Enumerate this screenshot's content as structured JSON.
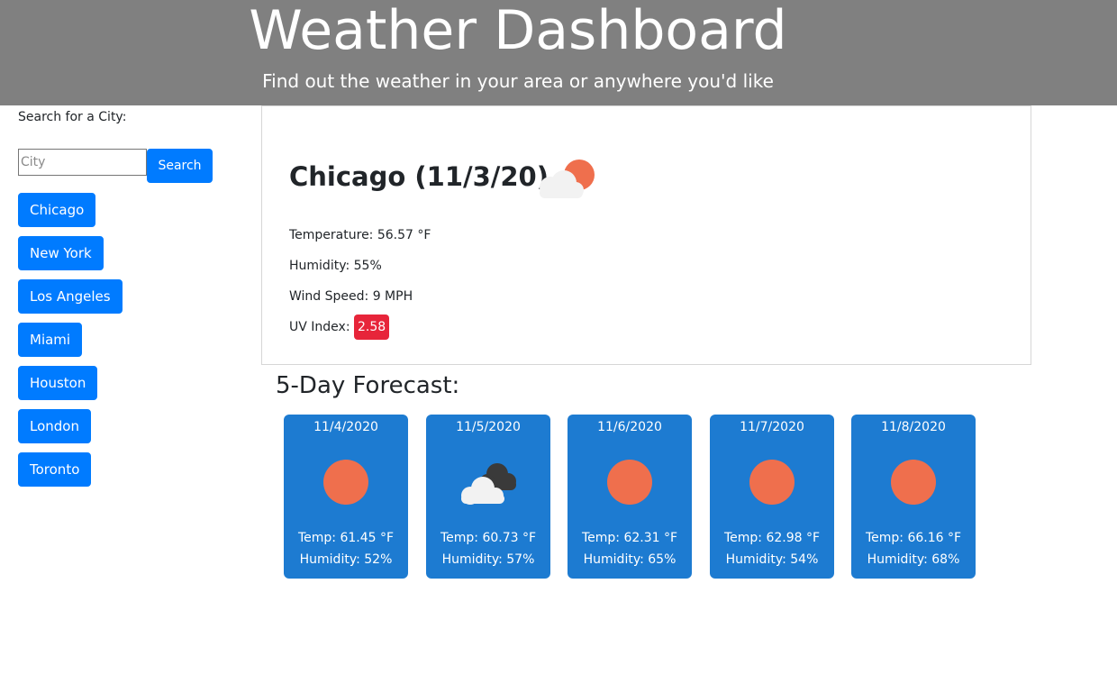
{
  "header": {
    "title": "Weather Dashboard",
    "subtitle": "Find out the weather in your area or anywhere you'd like"
  },
  "sidebar": {
    "search_label": "Search for a City:",
    "search_placeholder": "City",
    "search_value": "",
    "search_button": "Search",
    "cities": [
      "Chicago",
      "New York",
      "Los Angeles",
      "Miami",
      "Houston",
      "London",
      "Toronto"
    ]
  },
  "current": {
    "heading": "Chicago (11/3/20)",
    "icon": "partly-cloudy-icon",
    "temperature": "Temperature: 56.57 °F",
    "humidity": "Humidity: 55%",
    "wind": "Wind Speed: 9 MPH",
    "uv_label": "UV Index: ",
    "uv_value": "2.58",
    "uv_color": "#e7253a"
  },
  "forecast": {
    "title": "5-Day Forecast:",
    "card_color": "#1d7bd1",
    "days": [
      {
        "date": "11/4/2020",
        "icon": "sun-icon",
        "temp": "Temp: 61.45 °F",
        "humidity": "Humidity: 52%"
      },
      {
        "date": "11/5/2020",
        "icon": "cloudy-icon",
        "temp": "Temp: 60.73 °F",
        "humidity": "Humidity: 57%"
      },
      {
        "date": "11/6/2020",
        "icon": "sun-icon",
        "temp": "Temp: 62.31 °F",
        "humidity": "Humidity: 65%"
      },
      {
        "date": "11/7/2020",
        "icon": "sun-icon",
        "temp": "Temp: 62.98 °F",
        "humidity": "Humidity: 54%"
      },
      {
        "date": "11/8/2020",
        "icon": "sun-icon",
        "temp": "Temp: 66.16 °F",
        "humidity": "Humidity: 68%"
      }
    ]
  },
  "colors": {
    "header_bg": "#808080",
    "button_primary": "#007bff",
    "sun": "#ef6f4d"
  }
}
